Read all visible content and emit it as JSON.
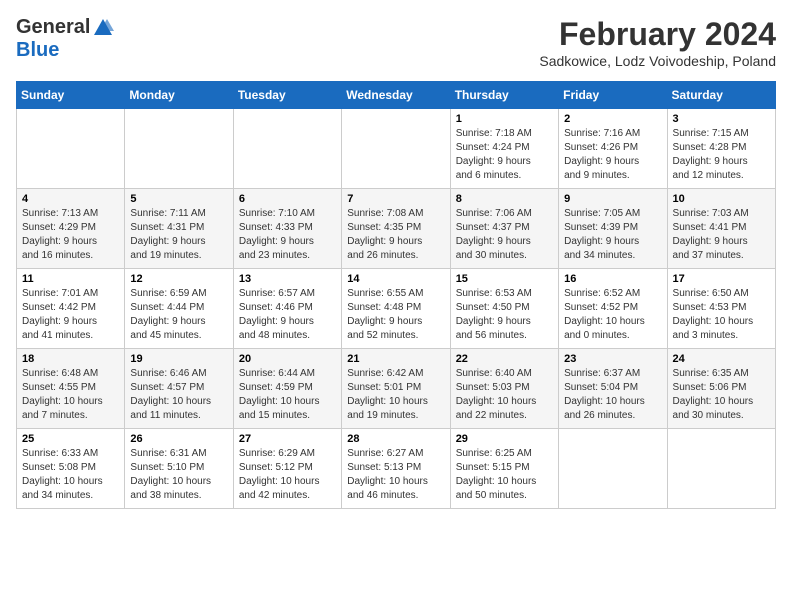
{
  "logo": {
    "general": "General",
    "blue": "Blue"
  },
  "title": "February 2024",
  "subtitle": "Sadkowice, Lodz Voivodeship, Poland",
  "headers": [
    "Sunday",
    "Monday",
    "Tuesday",
    "Wednesday",
    "Thursday",
    "Friday",
    "Saturday"
  ],
  "weeks": [
    [
      {
        "day": "",
        "info": ""
      },
      {
        "day": "",
        "info": ""
      },
      {
        "day": "",
        "info": ""
      },
      {
        "day": "",
        "info": ""
      },
      {
        "day": "1",
        "info": "Sunrise: 7:18 AM\nSunset: 4:24 PM\nDaylight: 9 hours\nand 6 minutes."
      },
      {
        "day": "2",
        "info": "Sunrise: 7:16 AM\nSunset: 4:26 PM\nDaylight: 9 hours\nand 9 minutes."
      },
      {
        "day": "3",
        "info": "Sunrise: 7:15 AM\nSunset: 4:28 PM\nDaylight: 9 hours\nand 12 minutes."
      }
    ],
    [
      {
        "day": "4",
        "info": "Sunrise: 7:13 AM\nSunset: 4:29 PM\nDaylight: 9 hours\nand 16 minutes."
      },
      {
        "day": "5",
        "info": "Sunrise: 7:11 AM\nSunset: 4:31 PM\nDaylight: 9 hours\nand 19 minutes."
      },
      {
        "day": "6",
        "info": "Sunrise: 7:10 AM\nSunset: 4:33 PM\nDaylight: 9 hours\nand 23 minutes."
      },
      {
        "day": "7",
        "info": "Sunrise: 7:08 AM\nSunset: 4:35 PM\nDaylight: 9 hours\nand 26 minutes."
      },
      {
        "day": "8",
        "info": "Sunrise: 7:06 AM\nSunset: 4:37 PM\nDaylight: 9 hours\nand 30 minutes."
      },
      {
        "day": "9",
        "info": "Sunrise: 7:05 AM\nSunset: 4:39 PM\nDaylight: 9 hours\nand 34 minutes."
      },
      {
        "day": "10",
        "info": "Sunrise: 7:03 AM\nSunset: 4:41 PM\nDaylight: 9 hours\nand 37 minutes."
      }
    ],
    [
      {
        "day": "11",
        "info": "Sunrise: 7:01 AM\nSunset: 4:42 PM\nDaylight: 9 hours\nand 41 minutes."
      },
      {
        "day": "12",
        "info": "Sunrise: 6:59 AM\nSunset: 4:44 PM\nDaylight: 9 hours\nand 45 minutes."
      },
      {
        "day": "13",
        "info": "Sunrise: 6:57 AM\nSunset: 4:46 PM\nDaylight: 9 hours\nand 48 minutes."
      },
      {
        "day": "14",
        "info": "Sunrise: 6:55 AM\nSunset: 4:48 PM\nDaylight: 9 hours\nand 52 minutes."
      },
      {
        "day": "15",
        "info": "Sunrise: 6:53 AM\nSunset: 4:50 PM\nDaylight: 9 hours\nand 56 minutes."
      },
      {
        "day": "16",
        "info": "Sunrise: 6:52 AM\nSunset: 4:52 PM\nDaylight: 10 hours\nand 0 minutes."
      },
      {
        "day": "17",
        "info": "Sunrise: 6:50 AM\nSunset: 4:53 PM\nDaylight: 10 hours\nand 3 minutes."
      }
    ],
    [
      {
        "day": "18",
        "info": "Sunrise: 6:48 AM\nSunset: 4:55 PM\nDaylight: 10 hours\nand 7 minutes."
      },
      {
        "day": "19",
        "info": "Sunrise: 6:46 AM\nSunset: 4:57 PM\nDaylight: 10 hours\nand 11 minutes."
      },
      {
        "day": "20",
        "info": "Sunrise: 6:44 AM\nSunset: 4:59 PM\nDaylight: 10 hours\nand 15 minutes."
      },
      {
        "day": "21",
        "info": "Sunrise: 6:42 AM\nSunset: 5:01 PM\nDaylight: 10 hours\nand 19 minutes."
      },
      {
        "day": "22",
        "info": "Sunrise: 6:40 AM\nSunset: 5:03 PM\nDaylight: 10 hours\nand 22 minutes."
      },
      {
        "day": "23",
        "info": "Sunrise: 6:37 AM\nSunset: 5:04 PM\nDaylight: 10 hours\nand 26 minutes."
      },
      {
        "day": "24",
        "info": "Sunrise: 6:35 AM\nSunset: 5:06 PM\nDaylight: 10 hours\nand 30 minutes."
      }
    ],
    [
      {
        "day": "25",
        "info": "Sunrise: 6:33 AM\nSunset: 5:08 PM\nDaylight: 10 hours\nand 34 minutes."
      },
      {
        "day": "26",
        "info": "Sunrise: 6:31 AM\nSunset: 5:10 PM\nDaylight: 10 hours\nand 38 minutes."
      },
      {
        "day": "27",
        "info": "Sunrise: 6:29 AM\nSunset: 5:12 PM\nDaylight: 10 hours\nand 42 minutes."
      },
      {
        "day": "28",
        "info": "Sunrise: 6:27 AM\nSunset: 5:13 PM\nDaylight: 10 hours\nand 46 minutes."
      },
      {
        "day": "29",
        "info": "Sunrise: 6:25 AM\nSunset: 5:15 PM\nDaylight: 10 hours\nand 50 minutes."
      },
      {
        "day": "",
        "info": ""
      },
      {
        "day": "",
        "info": ""
      }
    ]
  ]
}
